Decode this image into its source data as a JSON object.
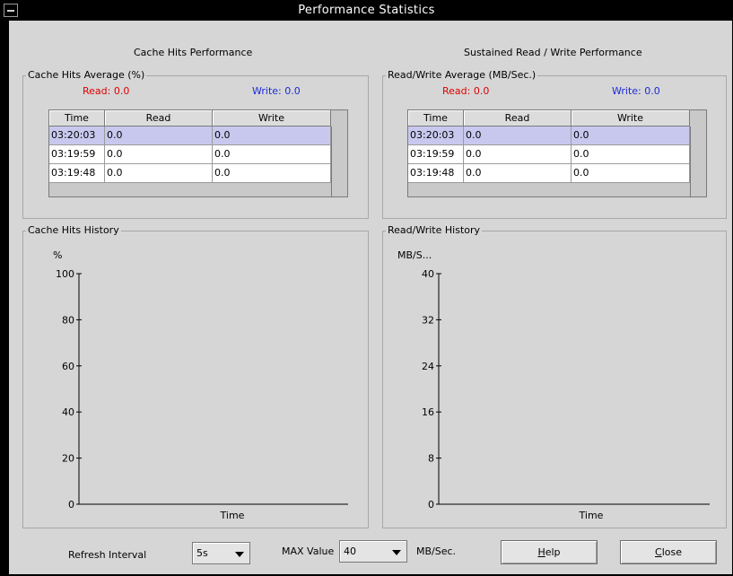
{
  "window": {
    "title": "Performance Statistics"
  },
  "left": {
    "section_title": "Cache Hits Performance",
    "avg_group_label": "Cache Hits Average (%)",
    "read_summary": "Read:  0.0",
    "write_summary": "Write:  0.0",
    "table": {
      "columns": [
        "Time",
        "Read",
        "Write"
      ],
      "rows": [
        [
          "03:20:03",
          "0.0",
          "0.0"
        ],
        [
          "03:19:59",
          "0.0",
          "0.0"
        ],
        [
          "03:19:48",
          "0.0",
          "0.0"
        ]
      ],
      "selected_row": 0
    },
    "history_group_label": "Cache Hits  History"
  },
  "right": {
    "section_title": "Sustained Read / Write Performance",
    "avg_group_label": "Read/Write Average (MB/Sec.)",
    "read_summary": "Read:  0.0",
    "write_summary": "Write:  0.0",
    "table": {
      "columns": [
        "Time",
        "Read",
        "Write"
      ],
      "rows": [
        [
          "03:20:03",
          "0.0",
          "0.0"
        ],
        [
          "03:19:59",
          "0.0",
          "0.0"
        ],
        [
          "03:19:48",
          "0.0",
          "0.0"
        ]
      ],
      "selected_row": 0
    },
    "history_group_label": "Read/Write History"
  },
  "chart_data": [
    {
      "type": "line",
      "ylabel": "%",
      "xlabel": "Time",
      "ylim": [
        0,
        100
      ],
      "yticks": [
        0,
        20,
        40,
        60,
        80,
        100
      ],
      "series": []
    },
    {
      "type": "line",
      "ylabel": "MB/S...",
      "xlabel": "Time",
      "ylim": [
        0,
        40
      ],
      "yticks": [
        0,
        8,
        16,
        24,
        32,
        40
      ],
      "series": []
    }
  ],
  "bottom": {
    "refresh_label": "Refresh Interval",
    "refresh_value": "5s",
    "max_label": "MAX Value",
    "max_value": "40",
    "max_unit": "MB/Sec.",
    "help_mnemonic": "H",
    "help_rest": "elp",
    "close_mnemonic": "C",
    "close_rest": "lose"
  },
  "colors": {
    "read": "#e00000",
    "write": "#1c2ad8",
    "selected_row": "#c8c8ef"
  }
}
